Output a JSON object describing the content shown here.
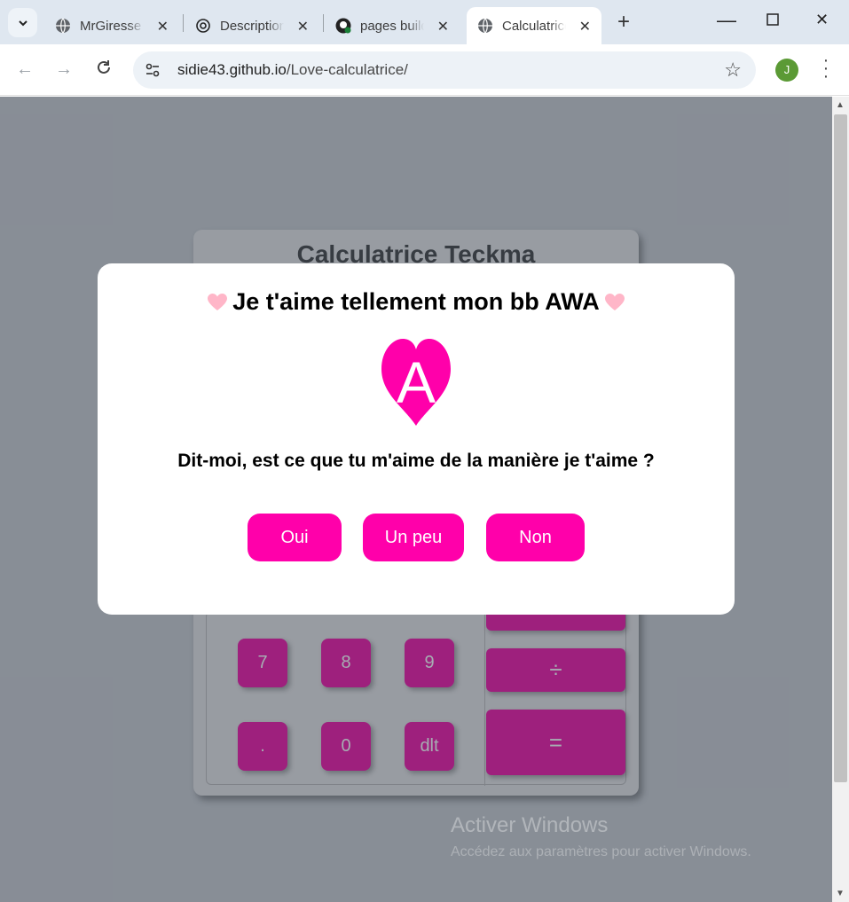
{
  "browser": {
    "tabs": [
      {
        "title": "MrGiresse",
        "active": false
      },
      {
        "title": "Description",
        "active": false
      },
      {
        "title": "pages build",
        "active": false
      },
      {
        "title": "Calculatrice",
        "active": true
      }
    ],
    "url_host": "sidie43.github.io",
    "url_path": "/Love-calculatrice/",
    "profile_initial": "J"
  },
  "calculator": {
    "title": "Calculatrice Teckma",
    "keys": [
      "7",
      "8",
      "9",
      ".",
      "0",
      "dlt"
    ],
    "operators": [
      "×",
      "÷",
      "="
    ]
  },
  "modal": {
    "title": "Je t'aime tellement mon bb AWA",
    "heart_letter": "A",
    "question": "Dit-moi, est ce que tu m'aime de la manière je t'aime ?",
    "buttons": {
      "yes": "Oui",
      "little": "Un peu",
      "no": "Non"
    }
  },
  "watermark": {
    "line1": "Activer Windows",
    "line2": "Accédez aux paramètres pour activer Windows."
  },
  "colors": {
    "accent_pink": "#ff00aa",
    "light_pink": "#ffb6c8",
    "calc_key": "#ee009f"
  }
}
